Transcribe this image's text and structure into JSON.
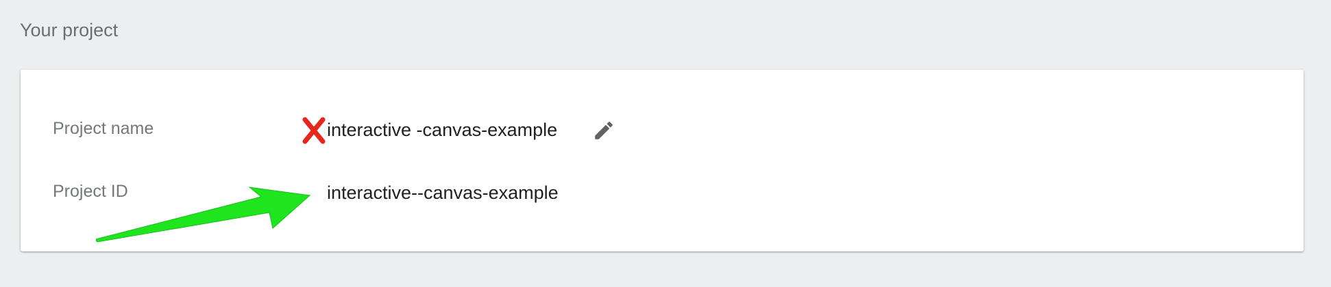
{
  "section": {
    "title": "Your project"
  },
  "project": {
    "name_label": "Project name",
    "name_value": "interactive -canvas-example",
    "id_label": "Project ID",
    "id_value": "interactive--canvas-example"
  },
  "icons": {
    "edit": "pencil-icon",
    "annotation_mark": "x-mark-icon",
    "annotation_arrow": "arrow-icon"
  },
  "colors": {
    "background": "#eceff1",
    "card": "#ffffff",
    "label_text": "#74787b",
    "value_text": "#202124",
    "edit_icon": "#5f6368",
    "x_mark": "#e8261c",
    "arrow": "#1ee51e"
  }
}
